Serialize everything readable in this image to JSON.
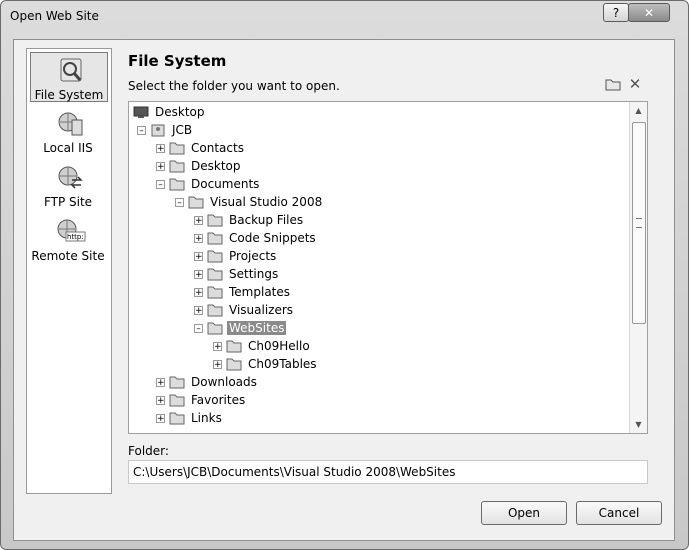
{
  "window": {
    "title": "Open Web Site",
    "help": "?",
    "close": "✕"
  },
  "sidebar": {
    "items": [
      {
        "label": "File System",
        "icon": "file-system-icon"
      },
      {
        "label": "Local IIS",
        "icon": "local-iis-icon"
      },
      {
        "label": "FTP Site",
        "icon": "ftp-site-icon"
      },
      {
        "label": "Remote Site",
        "icon": "remote-site-icon"
      }
    ]
  },
  "main": {
    "heading": "File System",
    "prompt": "Select the folder you want to open.",
    "tree": [
      {
        "label": "Desktop",
        "icon": "desktop-icon"
      },
      {
        "label": "JCB",
        "icon": "user-folder-icon"
      },
      {
        "label": "Contacts",
        "icon": "folder-icon"
      },
      {
        "label": "Desktop",
        "icon": "folder-icon"
      },
      {
        "label": "Documents",
        "icon": "folder-icon"
      },
      {
        "label": "Visual Studio 2008",
        "icon": "folder-icon"
      },
      {
        "label": "Backup Files",
        "icon": "folder-icon"
      },
      {
        "label": "Code Snippets",
        "icon": "folder-icon"
      },
      {
        "label": "Projects",
        "icon": "folder-icon"
      },
      {
        "label": "Settings",
        "icon": "folder-icon"
      },
      {
        "label": "Templates",
        "icon": "folder-icon"
      },
      {
        "label": "Visualizers",
        "icon": "folder-icon"
      },
      {
        "label": "WebSites",
        "icon": "folder-icon"
      },
      {
        "label": "Ch09Hello",
        "icon": "folder-icon"
      },
      {
        "label": "Ch09Tables",
        "icon": "folder-icon"
      },
      {
        "label": "Downloads",
        "icon": "folder-icon"
      },
      {
        "label": "Favorites",
        "icon": "folder-icon"
      },
      {
        "label": "Links",
        "icon": "folder-icon"
      }
    ],
    "folder_label": "Folder:",
    "folder_value": "C:\\Users\\JCB\\Documents\\Visual Studio 2008\\WebSites"
  },
  "buttons": {
    "open": "Open",
    "cancel": "Cancel"
  }
}
